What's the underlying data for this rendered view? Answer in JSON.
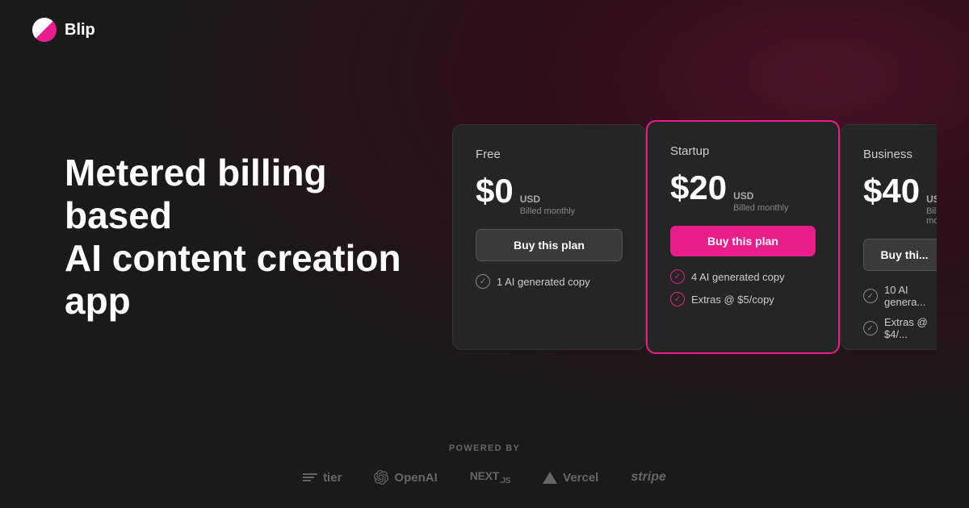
{
  "app": {
    "name": "Blip"
  },
  "hero": {
    "title_line1": "Metered billing based",
    "title_line2": "AI content creation app"
  },
  "pricing": {
    "plans": [
      {
        "id": "free",
        "name": "Free",
        "price": "$0",
        "currency": "USD",
        "billing": "Billed monthly",
        "button_label": "Buy this plan",
        "button_type": "default",
        "features": [
          "1 AI generated copy"
        ]
      },
      {
        "id": "startup",
        "name": "Startup",
        "price": "$20",
        "currency": "USD",
        "billing": "Billed monthly",
        "button_label": "Buy this plan",
        "button_type": "featured",
        "features": [
          "4 AI generated copy",
          "Extras @ $5/copy"
        ],
        "featured": true
      },
      {
        "id": "business",
        "name": "Business",
        "price": "$40",
        "currency": "USD",
        "billing": "Billed mo...",
        "button_label": "Buy thi...",
        "button_type": "default",
        "features": [
          "10 AI genera...",
          "Extras @ $4/..."
        ]
      }
    ]
  },
  "footer": {
    "powered_by_label": "POWERED BY",
    "logos": [
      {
        "name": "tier",
        "label": "tier"
      },
      {
        "name": "openai",
        "label": "OpenAI"
      },
      {
        "name": "nextjs",
        "label": "NEXT.JS"
      },
      {
        "name": "vercel",
        "label": "Vercel"
      },
      {
        "name": "stripe",
        "label": "stripe"
      }
    ]
  }
}
